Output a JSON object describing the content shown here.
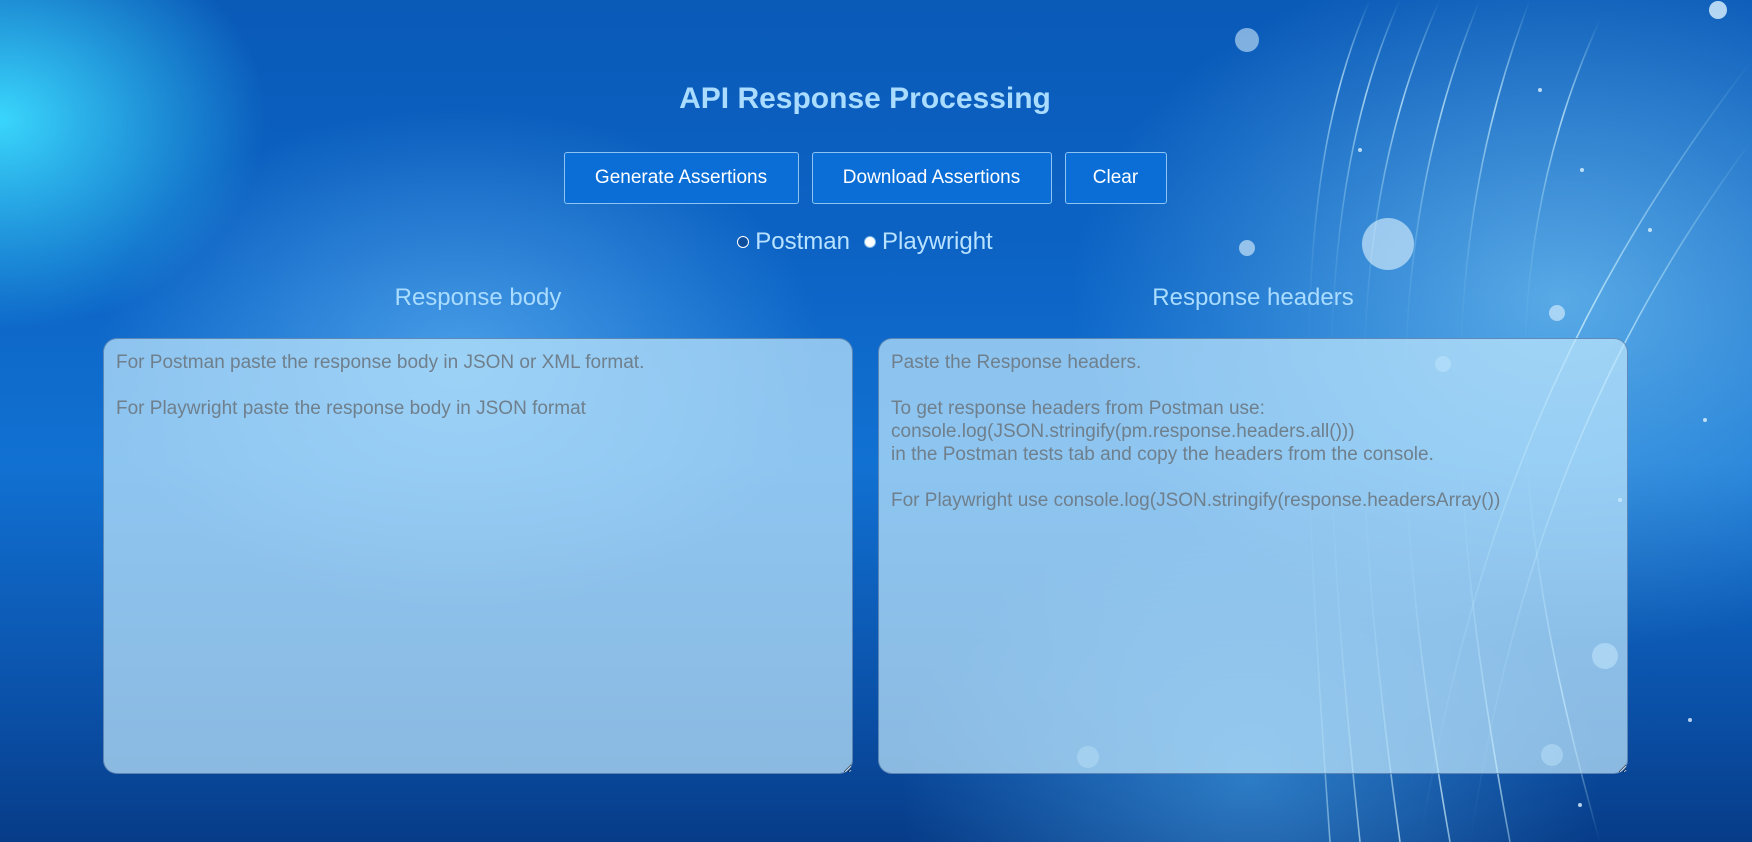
{
  "page": {
    "title": "API Response Processing"
  },
  "toolbar": {
    "generate_label": "Generate Assertions",
    "download_label": "Download Assertions",
    "clear_label": "Clear"
  },
  "framework": {
    "options": [
      {
        "label": "Postman",
        "selected": false
      },
      {
        "label": "Playwright",
        "selected": true
      }
    ]
  },
  "panels": {
    "body": {
      "label": "Response body",
      "value": "",
      "placeholder": "For Postman paste the response body in JSON or XML format.\n\nFor Playwright paste the response body in JSON format"
    },
    "headers": {
      "label": "Response headers",
      "value": "",
      "placeholder": "Paste the Response headers.\n\nTo get response headers from Postman use:\nconsole.log(JSON.stringify(pm.response.headers.all()))\nin the Postman tests tab and copy the headers from the console.\n\nFor Playwright use console.log(JSON.stringify(response.headersArray())"
    }
  },
  "colors": {
    "title": "#a9dcff",
    "button_bg": "#0a6ed6",
    "textarea_bg": "#bee6fc"
  }
}
